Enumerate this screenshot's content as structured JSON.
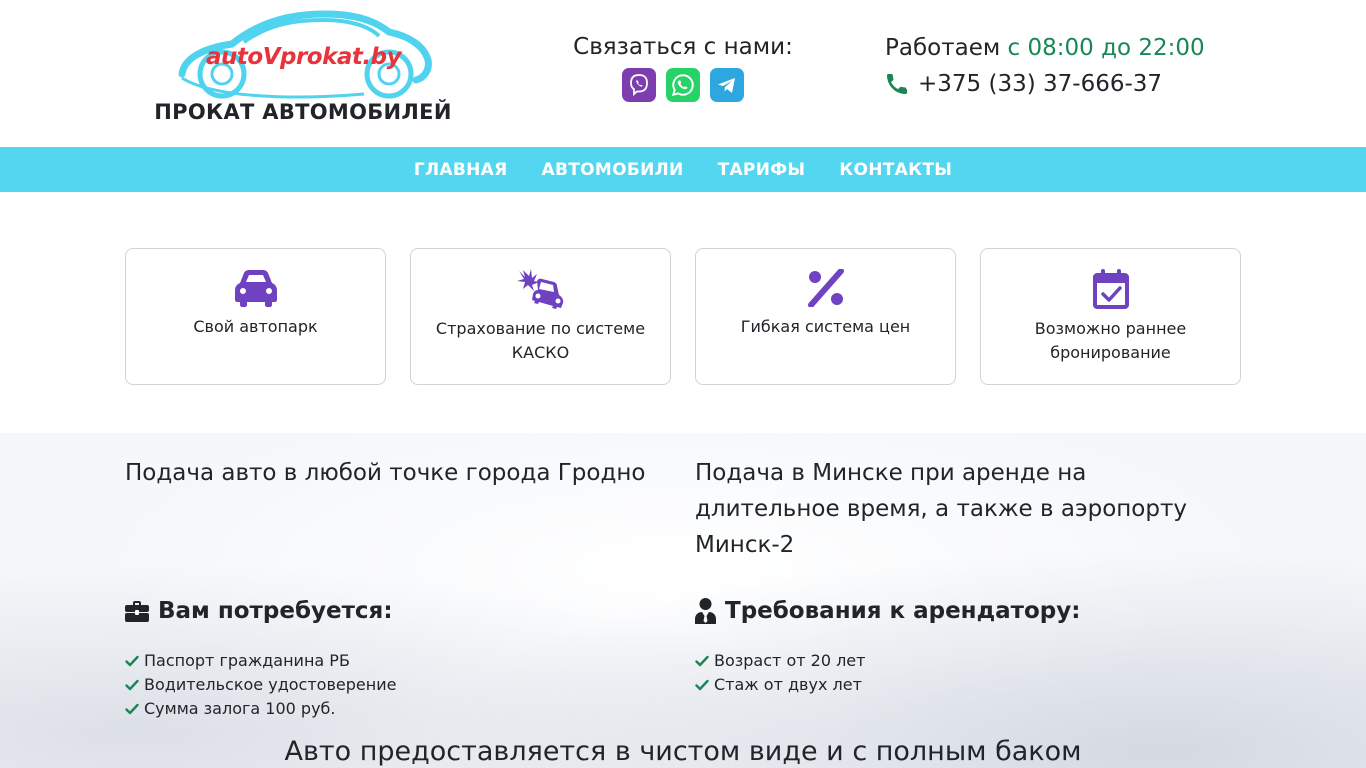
{
  "header": {
    "logo_text": "autoVprokat.by",
    "logo_subtitle": "ПРОКАТ АВТОМОБИЛЕЙ",
    "contact_title": "Связаться с нами:",
    "messengers": [
      {
        "name": "viber-icon",
        "color": "#7d3daf"
      },
      {
        "name": "whatsapp-icon",
        "color": "#25d366"
      },
      {
        "name": "telegram-icon",
        "color": "#2ea6e0"
      }
    ],
    "hours_label": "Работаем",
    "hours_value": "с 08:00 до 22:00",
    "phone": "+375 (33) 37-666-37"
  },
  "nav": {
    "items": [
      "ГЛАВНАЯ",
      "АВТОМОБИЛИ",
      "ТАРИФЫ",
      "КОНТАКТЫ"
    ],
    "background": "#53d6ef"
  },
  "features": [
    {
      "icon": "car-icon",
      "label": "Свой автопарк"
    },
    {
      "icon": "car-crash-icon",
      "label": "Страхование по системе КАСКО"
    },
    {
      "icon": "percent-icon",
      "label": "Гибкая система цен"
    },
    {
      "icon": "calendar-check-icon",
      "label": "Возможно раннее бронирование"
    }
  ],
  "accent_color": "#6f42c1",
  "delivery": {
    "grodno": "Подача авто в любой точке города Гродно",
    "minsk": "Подача в Минске при аренде на длительное время, а также в аэропорту Минск-2"
  },
  "requirements": {
    "docs_title": "Вам потребуется:",
    "docs": [
      "Паспорт гражданина РБ",
      "Водительское удостоверение",
      "Сумма залога 100 руб."
    ],
    "renter_title": "Требования к арендатору:",
    "renter": [
      "Возраст от 20 лет",
      "Стаж от двух лет"
    ]
  },
  "bottom_note": "Авто предоставляется в чистом виде и с полным баком"
}
